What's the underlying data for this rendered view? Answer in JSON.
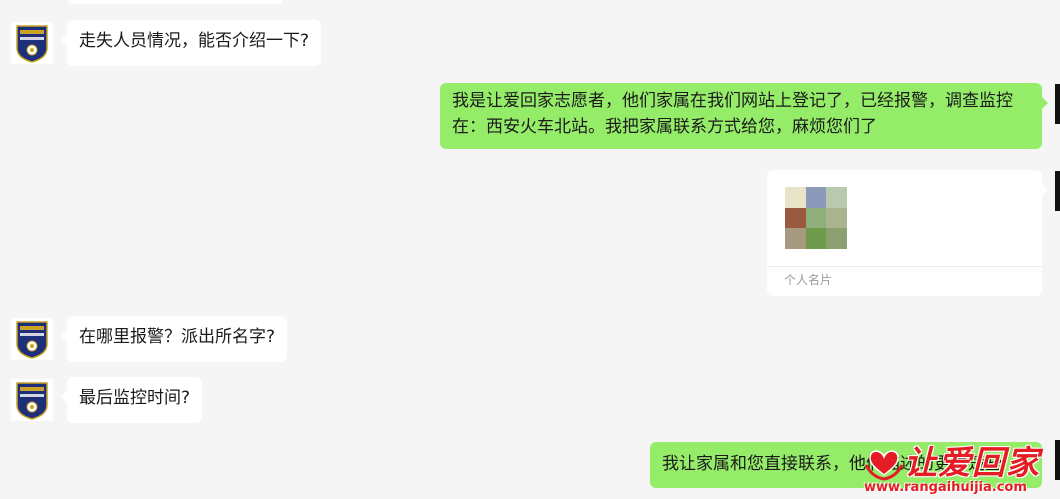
{
  "colors": {
    "background": "#f5f5f5",
    "incoming_bubble": "#ffffff",
    "outgoing_bubble": "#95ec69",
    "watermark": "#e51c24"
  },
  "avatar_icon": "police-badge-icon",
  "messages": [
    {
      "direction": "incoming",
      "text": "走失人员情况，能否介绍一下?"
    },
    {
      "direction": "outgoing",
      "text": "我是让爱回家志愿者，他们家属在我们网站上登记了，已经报警，调查监控在：西安火车北站。我把家属联系方式给您，麻烦您们了"
    },
    {
      "direction": "outgoing",
      "type": "contact-card",
      "label": "个人名片",
      "photo_icon": "mosaic-avatar-icon"
    },
    {
      "direction": "incoming",
      "text": "在哪里报警？派出所名字?"
    },
    {
      "direction": "incoming",
      "text": "最后监控时间?"
    },
    {
      "direction": "outgoing",
      "text": "我让家属和您直接联系，他们描述的更清楚些"
    }
  ],
  "watermark": {
    "title": "让爱回家",
    "url": "www.rangaihuijia.com",
    "icon": "heart-hands-icon"
  }
}
